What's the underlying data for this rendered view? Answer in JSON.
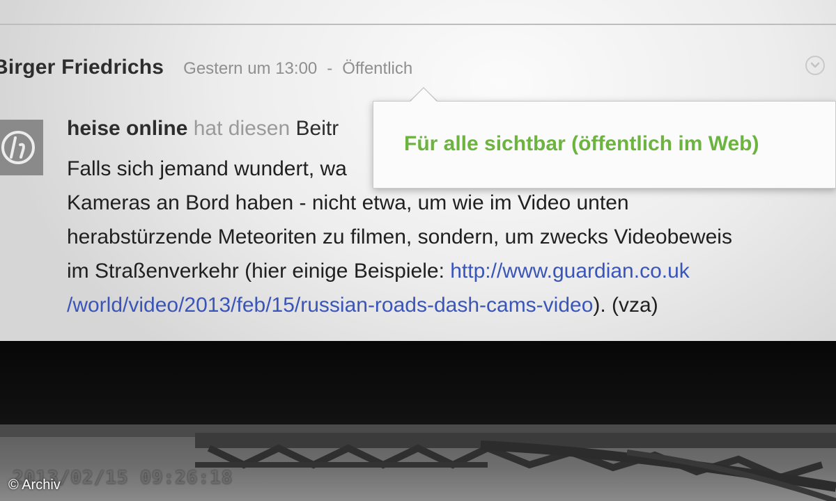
{
  "post": {
    "author": "Birger Friedrichs",
    "time": "Gestern um 13:00",
    "separator": "-",
    "visibility": "Öffentlich"
  },
  "share": {
    "author": "heise online",
    "verb": "hat diesen",
    "object": "Beitr"
  },
  "body": {
    "line1": "Falls sich jemand wundert, wa",
    "line2": "Kameras an Bord haben - nicht etwa, um wie im Video unten",
    "line3": "herabstürzende Meteoriten zu filmen, sondern, um zwecks Videobeweis",
    "line4_text": "im Straßenverkehr (hier einige Beispiele: ",
    "line4_link": "http://www.guardian.co.uk",
    "line5_link": "/world/video/2013/feb/15/russian-roads-dash-cams-video",
    "line5_text": "). (vza)"
  },
  "tooltip": {
    "text": "Für alle sichtbar (öffentlich im Web)"
  },
  "video": {
    "timestamp": "2013/02/15 09:26:18"
  },
  "copyright": "© Archiv",
  "colors": {
    "tooltip_text": "#6db33f",
    "link": "#3a55b8",
    "muted_text": "#8f8f8f"
  },
  "icons": {
    "menu": "chevron-down-icon",
    "avatar": "heise-logo-icon"
  }
}
